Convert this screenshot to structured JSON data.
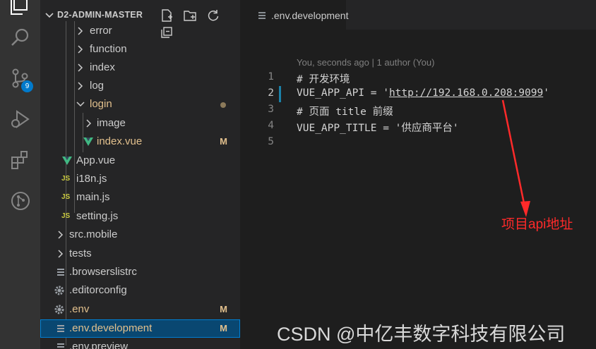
{
  "activity_bar": {
    "icons": [
      "explorer-icon",
      "search-icon",
      "source-control-icon",
      "run-debug-icon",
      "extensions-icon",
      "git-graph-icon"
    ],
    "source_control_badge": "9"
  },
  "explorer": {
    "title": "D2-ADMIN-MASTER",
    "actions": [
      "new-file-icon",
      "new-folder-icon",
      "refresh-icon",
      "collapse-all-icon"
    ],
    "items": [
      {
        "label": "error",
        "type": "folder"
      },
      {
        "label": "function",
        "type": "folder"
      },
      {
        "label": "index",
        "type": "folder"
      },
      {
        "label": "log",
        "type": "folder"
      },
      {
        "label": "login",
        "type": "folder-open",
        "status": "modified-dot"
      },
      {
        "label": "image",
        "type": "folder"
      },
      {
        "label": "index.vue",
        "type": "vue",
        "status": "M"
      },
      {
        "label": "App.vue",
        "type": "vue"
      },
      {
        "label": "i18n.js",
        "type": "js",
        "icon_text": "JS"
      },
      {
        "label": "main.js",
        "type": "js",
        "icon_text": "JS"
      },
      {
        "label": "setting.js",
        "type": "js",
        "icon_text": "JS"
      },
      {
        "label": "src.mobile",
        "type": "folder"
      },
      {
        "label": "tests",
        "type": "folder"
      },
      {
        "label": ".browserslistrc",
        "type": "text"
      },
      {
        "label": ".editorconfig",
        "type": "gear"
      },
      {
        "label": ".env",
        "type": "gear",
        "status": "M"
      },
      {
        "label": ".env.development",
        "type": "text",
        "status": "M"
      },
      {
        "label": ".env.preview",
        "type": "text"
      }
    ]
  },
  "editor": {
    "tab_label": ".env.development",
    "blame": "You, seconds ago | 1 author (You)",
    "lines": [
      {
        "number": "1",
        "text": "# 开发环境"
      },
      {
        "number": "2",
        "text_before": "VUE_APP_API = '",
        "url": "http://192.168.0.208:9099",
        "text_after": "'"
      },
      {
        "number": "3",
        "text": "# 页面 title 前缀"
      },
      {
        "number": "4",
        "text": "VUE_APP_TITLE = '供应商平台'"
      },
      {
        "number": "5",
        "text": ""
      }
    ]
  },
  "annotation": "项目api地址",
  "watermark": "CSDN @中亿丰数字科技有限公司",
  "colors": {
    "activity_bg": "#333333",
    "sidebar_bg": "#252526",
    "editor_bg": "#1e1e1e",
    "selection": "#094771",
    "badge": "#007acc",
    "modified": "#e2c08d",
    "vue_green": "#41b883",
    "js_yellow": "#cbcb41",
    "annotation_red": "#ff2a2a"
  }
}
